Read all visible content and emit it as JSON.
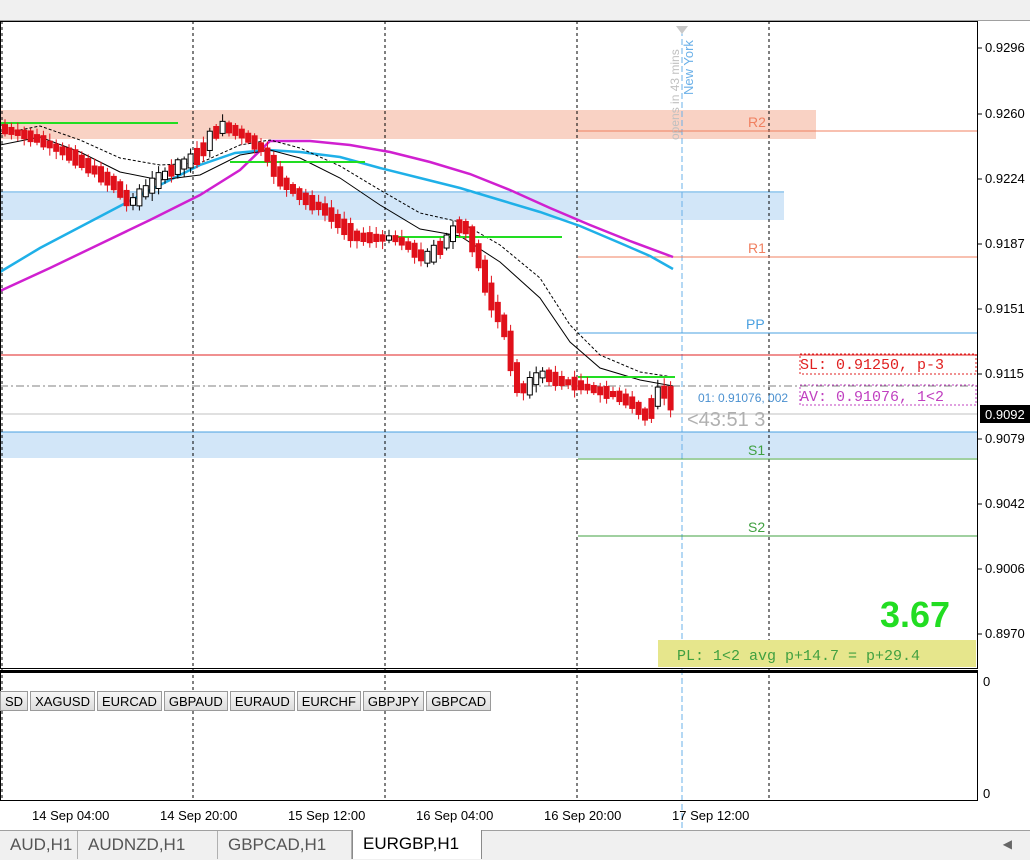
{
  "chart": {
    "symbol_tf": "EURGBP,H1",
    "price_axis": [
      "0.9296",
      "0.9260",
      "0.9224",
      "0.9187",
      "0.9151",
      "0.9115",
      "0.9079",
      "0.9042",
      "0.9006",
      "0.8970"
    ],
    "current_price": "0.9092",
    "time_axis": [
      "14 Sep 04:00",
      "14 Sep 20:00",
      "15 Sep 12:00",
      "16 Sep 04:00",
      "16 Sep 20:00",
      "17 Sep 12:00"
    ],
    "indicator_axis": [
      "0",
      "0"
    ],
    "pivot_labels": {
      "r2": "R2",
      "r1": "R1",
      "pp": "PP",
      "s1": "S1",
      "s2": "S2"
    },
    "session_text": "opens in 43 mins",
    "session_name": "New York",
    "sl_text": "SL: 0.91250, p-3",
    "av_text": "AV: 0.91076, 1<2",
    "order_text": "01: 0.91076, 002",
    "countdown": "<43:51  3",
    "pl_big": "3.67",
    "pl_box": "PL: 1<2 avg p+14.7 = p+29.4",
    "colors": {
      "bull": "#ffffff",
      "bear": "#e0101a",
      "ema_fast": "#1fb0e8",
      "ema_slow": "#d020d0",
      "level": "#22dd22",
      "zone_red": "#f9d2c4",
      "zone_blue": "#d2e6f8",
      "sl": "#e02020",
      "pl_green": "#22dd22",
      "pl_box_bg": "#e6e68c"
    }
  },
  "symbols": [
    "SD",
    "XAGUSD",
    "EURCAD",
    "GBPAUD",
    "EURAUD",
    "EURCHF",
    "GBPJPY",
    "GBPCAD"
  ],
  "tabs": [
    "AUD,H1",
    "AUDNZD,H1",
    "GBPCAD,H1",
    "EURGBP,H1"
  ],
  "active_tab": "EURGBP,H1"
}
